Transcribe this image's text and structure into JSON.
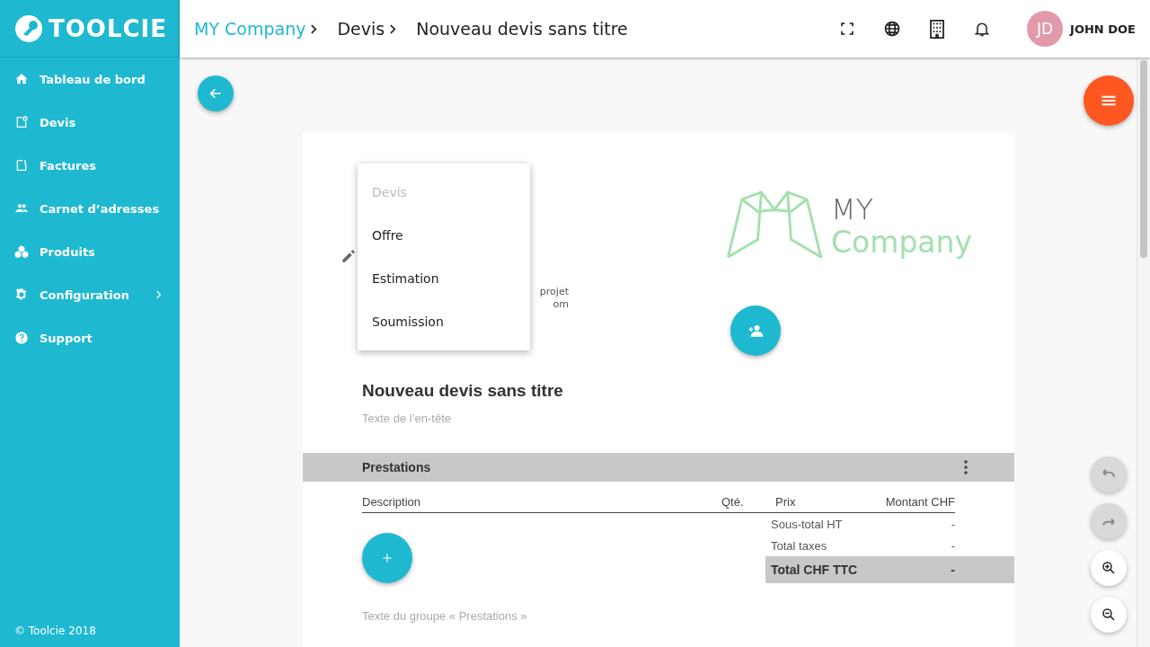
{
  "brand": {
    "name": "TOOLCIE"
  },
  "breadcrumb": [
    {
      "label": "MY Company",
      "kind": "link"
    },
    {
      "label": "Devis",
      "kind": "crumb"
    },
    {
      "label": "Nouveau devis sans titre",
      "kind": "current"
    }
  ],
  "user": {
    "initials": "JD",
    "name": "JOHN DOE"
  },
  "sidebar": {
    "items": [
      {
        "label": "Tableau de bord",
        "submenu": false
      },
      {
        "label": "Devis",
        "submenu": false
      },
      {
        "label": "Factures",
        "submenu": false
      },
      {
        "label": "Carnet d’adresses",
        "submenu": false
      },
      {
        "label": "Produits",
        "submenu": false
      },
      {
        "label": "Configuration",
        "submenu": true
      },
      {
        "label": "Support",
        "submenu": false
      }
    ],
    "footer": "© Toolcie 2018"
  },
  "type_menu": {
    "items": [
      {
        "label": "Devis",
        "disabled": true
      },
      {
        "label": "Offre",
        "disabled": false
      },
      {
        "label": "Estimation",
        "disabled": false
      },
      {
        "label": "Soumission",
        "disabled": false
      }
    ]
  },
  "covered_text": [
    "projet",
    "om"
  ],
  "logo": {
    "line1": "MY",
    "line2": "Company"
  },
  "document": {
    "title": "Nouveau devis sans titre",
    "header_placeholder": "Texte de l’en-tête",
    "group": {
      "title": "Prestations",
      "columns": [
        "Description",
        "Qté.",
        "Prix",
        "Montant CHF"
      ],
      "totals": [
        {
          "label": "Sous-total HT",
          "value": "-",
          "kind": "normal"
        },
        {
          "label": "Total taxes",
          "value": "-",
          "kind": "normal"
        },
        {
          "label": "Total CHF TTC",
          "value": "-",
          "kind": "grand"
        }
      ],
      "footer_placeholder": "Texte du groupe « Prestations »"
    }
  },
  "side_tools": [
    {
      "kind": "undo",
      "disabled": true
    },
    {
      "kind": "redo",
      "disabled": true
    },
    {
      "kind": "zoom-in",
      "disabled": false
    },
    {
      "kind": "zoom-out",
      "disabled": false
    }
  ]
}
